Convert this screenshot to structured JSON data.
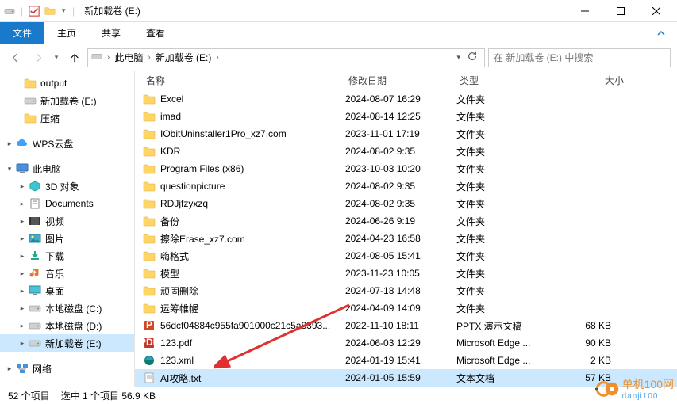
{
  "title": "新加载卷 (E:)",
  "ribbon": {
    "file": "文件",
    "home": "主页",
    "share": "共享",
    "view": "查看"
  },
  "breadcrumbs": {
    "root": "此电脑",
    "current": "新加载卷 (E:)"
  },
  "search_placeholder": "在 新加载卷 (E:) 中搜索",
  "tree": {
    "quick": [
      {
        "label": "output",
        "icon": "folder"
      },
      {
        "label": "新加载卷 (E:)",
        "icon": "drive"
      },
      {
        "label": "压缩",
        "icon": "folder"
      }
    ],
    "wps": {
      "label": "WPS云盘"
    },
    "thispc": {
      "label": "此电脑"
    },
    "pc_children": [
      {
        "label": "3D 对象",
        "icon": "3d"
      },
      {
        "label": "Documents",
        "icon": "docs"
      },
      {
        "label": "视频",
        "icon": "video"
      },
      {
        "label": "图片",
        "icon": "pics"
      },
      {
        "label": "下载",
        "icon": "dl"
      },
      {
        "label": "音乐",
        "icon": "music"
      },
      {
        "label": "桌面",
        "icon": "desktop"
      },
      {
        "label": "本地磁盘 (C:)",
        "icon": "drive"
      },
      {
        "label": "本地磁盘 (D:)",
        "icon": "drive"
      },
      {
        "label": "新加载卷 (E:)",
        "icon": "drive",
        "selected": true
      }
    ],
    "network": {
      "label": "网络"
    }
  },
  "columns": {
    "name": "名称",
    "date": "修改日期",
    "type": "类型",
    "size": "大小"
  },
  "files": [
    {
      "name": "Excel",
      "date": "2024-08-07 16:29",
      "type": "文件夹",
      "size": "",
      "kind": "folder"
    },
    {
      "name": "imad",
      "date": "2024-08-14 12:25",
      "type": "文件夹",
      "size": "",
      "kind": "folder"
    },
    {
      "name": "IObitUninstaller1Pro_xz7.com",
      "date": "2023-11-01 17:19",
      "type": "文件夹",
      "size": "",
      "kind": "folder"
    },
    {
      "name": "KDR",
      "date": "2024-08-02 9:35",
      "type": "文件夹",
      "size": "",
      "kind": "folder"
    },
    {
      "name": "Program Files (x86)",
      "date": "2023-10-03 10:20",
      "type": "文件夹",
      "size": "",
      "kind": "folder"
    },
    {
      "name": "questionpicture",
      "date": "2024-08-02 9:35",
      "type": "文件夹",
      "size": "",
      "kind": "folder"
    },
    {
      "name": "RDJjfzyxzq",
      "date": "2024-08-02 9:35",
      "type": "文件夹",
      "size": "",
      "kind": "folder"
    },
    {
      "name": "备份",
      "date": "2024-06-26 9:19",
      "type": "文件夹",
      "size": "",
      "kind": "folder"
    },
    {
      "name": "擦除Erase_xz7.com",
      "date": "2024-04-23 16:58",
      "type": "文件夹",
      "size": "",
      "kind": "folder"
    },
    {
      "name": "嗨格式",
      "date": "2024-08-05 15:41",
      "type": "文件夹",
      "size": "",
      "kind": "folder"
    },
    {
      "name": "模型",
      "date": "2023-11-23 10:05",
      "type": "文件夹",
      "size": "",
      "kind": "folder"
    },
    {
      "name": "顽固删除",
      "date": "2024-07-18 14:48",
      "type": "文件夹",
      "size": "",
      "kind": "folder"
    },
    {
      "name": "运筹帷幄",
      "date": "2024-04-09 14:09",
      "type": "文件夹",
      "size": "",
      "kind": "folder"
    },
    {
      "name": "56dcf04884c955fa901000c21c5a8393...",
      "date": "2022-11-10 18:11",
      "type": "PPTX 演示文稿",
      "size": "68 KB",
      "kind": "pptx"
    },
    {
      "name": "123.pdf",
      "date": "2024-06-03 12:29",
      "type": "Microsoft Edge ...",
      "size": "90 KB",
      "kind": "pdf"
    },
    {
      "name": "123.xml",
      "date": "2024-01-19 15:41",
      "type": "Microsoft Edge ...",
      "size": "2 KB",
      "kind": "edge"
    },
    {
      "name": "AI攻略.txt",
      "date": "2024-01-05 15:59",
      "type": "文本文档",
      "size": "57 KB",
      "kind": "txt",
      "selected": true
    }
  ],
  "status": {
    "count": "52 个项目",
    "selection": "选中 1 个项目 56.9 KB"
  },
  "watermark": {
    "brand": "单机100网",
    "sub": "danji100"
  }
}
